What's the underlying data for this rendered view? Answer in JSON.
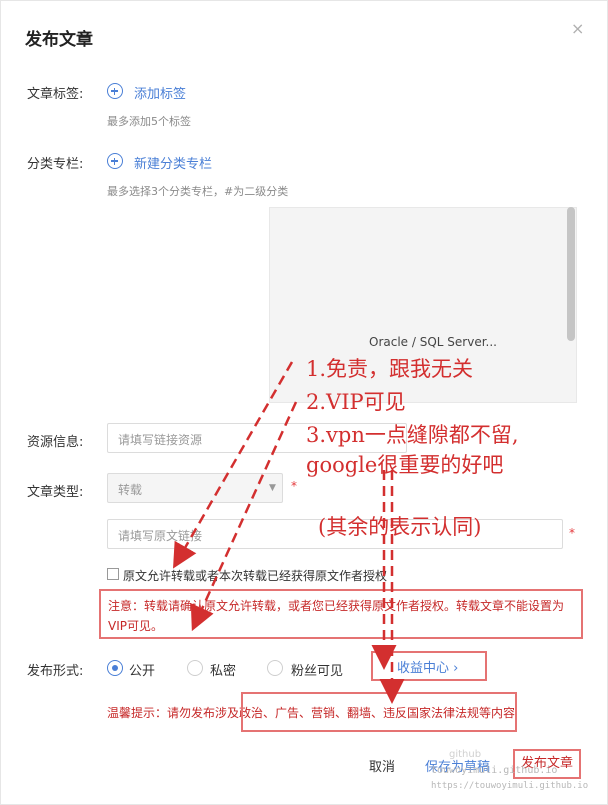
{
  "dialog": {
    "title": "发布文章",
    "close": "×"
  },
  "tags": {
    "label": "文章标签:",
    "add_link": "添加标签",
    "hint": "最多添加5个标签"
  },
  "category": {
    "label": "分类专栏:",
    "add_link": "新建分类专栏",
    "hint": "最多选择3个分类专栏，#为二级分类",
    "list_items": [
      "Oracle / SQL Server..."
    ]
  },
  "resource": {
    "label": "资源信息:",
    "placeholder": "请填写链接资源"
  },
  "article_type": {
    "label": "文章类型:",
    "selected": "转载",
    "source_placeholder": "请填写原文链接",
    "required": "*"
  },
  "authorization": {
    "label": "原文允许转载或者本次转载已经获得原文作者授权",
    "notice": "注意：转载请确认原文允许转载，或者您已经获得原文作者授权。转载文章不能设置为VIP可见。"
  },
  "publish_form": {
    "label": "发布形式:",
    "options": [
      "公开",
      "私密",
      "粉丝可见"
    ],
    "selected": "公开",
    "income_link": "收益中心 ›"
  },
  "warm_tip": "温馨提示：请勿发布涉及政治、广告、营销、翻墙、违反国家法律法规等内容",
  "buttons": {
    "cancel": "取消",
    "draft": "保存为草稿",
    "publish": "发布文章"
  },
  "watermark": {
    "line1": "github",
    "line2": "touwoyimuli.github.io",
    "line3": "https://touwoyimuli.github.io"
  },
  "annotations": {
    "line1": "1.免责，跟我无关",
    "line2": "2.VIP可见",
    "line3": "3.vpn一点缝隙都不留,",
    "line4": "google很重要的好吧",
    "line5": "(其余的表示认同)",
    "color": "#d32f2f"
  },
  "colors": {
    "accent": "#4a7fd6",
    "warning": "#c62828",
    "highlight_border": "#e57373"
  }
}
